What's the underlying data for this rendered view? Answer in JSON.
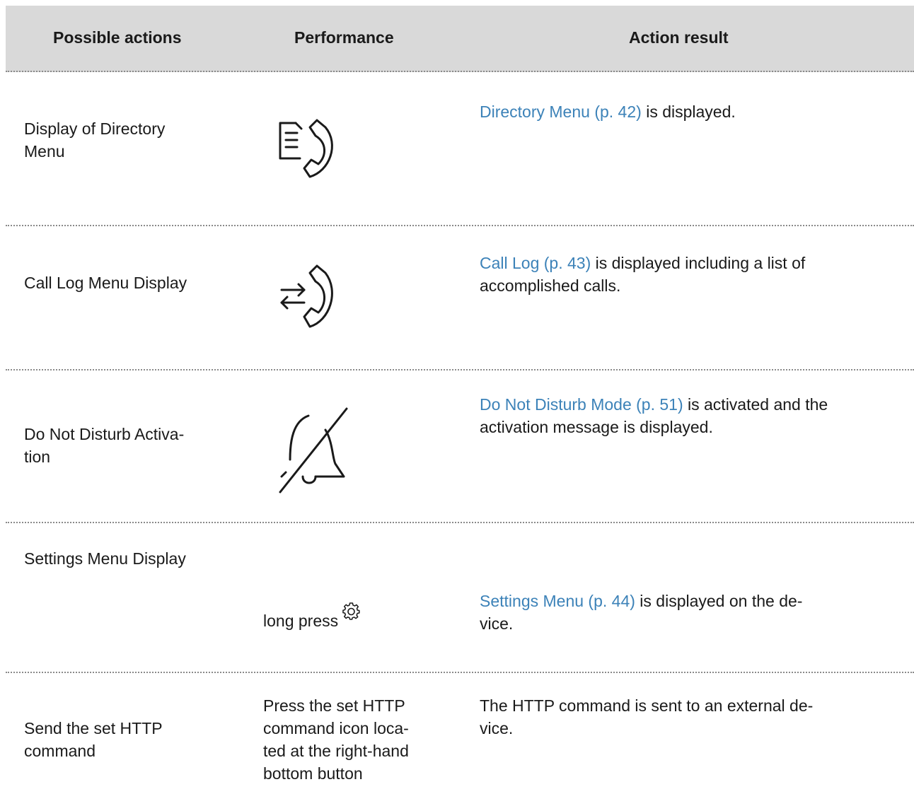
{
  "headers": {
    "actions": "Possible actions",
    "performance": "Performance",
    "result": "Action result"
  },
  "rows": [
    {
      "action_lines": [
        "Display of Directory",
        "Menu"
      ],
      "performance_icon": "directory-phone-icon",
      "result_link": "Directory Menu (p. 42)",
      "result_text": " is displayed."
    },
    {
      "action_lines": [
        "Call Log Menu Display"
      ],
      "performance_icon": "call-log-phone-icon",
      "result_link": "Call Log (p. 43)",
      "result_text_lines": [
        " is displayed including a list of",
        "accomplished calls."
      ]
    },
    {
      "action_lines": [
        "Do Not Disturb Activa-",
        "tion"
      ],
      "performance_icon": "bell-off-icon",
      "result_link": "Do Not Disturb Mode (p. 51)",
      "result_text_lines": [
        " is activated and the",
        "activation message is displayed."
      ]
    },
    {
      "action_lines": [
        "Settings Menu Display"
      ],
      "performance_text": "long press",
      "performance_icon": "gear-icon",
      "result_link": "Settings Menu (p. 44)",
      "result_text_lines": [
        " is displayed on the de-",
        "vice."
      ]
    },
    {
      "action_lines": [
        "Send the set HTTP",
        "command"
      ],
      "performance_lines": [
        "Press the set HTTP",
        "command icon loca-",
        "ted at the right-hand",
        "bottom button"
      ],
      "result_lines": [
        "The HTTP command is sent to an external de-",
        "vice."
      ]
    }
  ],
  "colors": {
    "header_bg": "#d9d9d9",
    "link": "#3c82b8",
    "rule": "#8a8a8a"
  }
}
